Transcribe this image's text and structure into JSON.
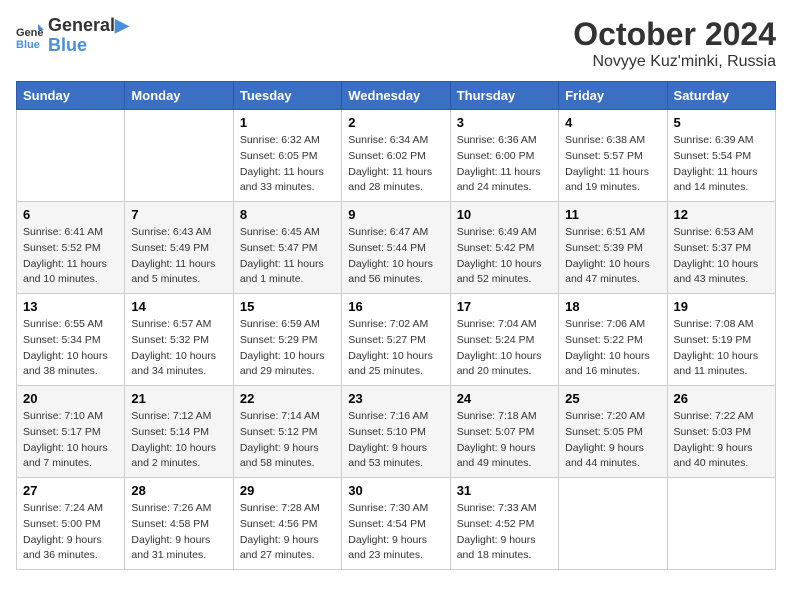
{
  "header": {
    "logo_line1": "General",
    "logo_line2": "Blue",
    "month": "October 2024",
    "location": "Novyye Kuz'minki, Russia"
  },
  "weekdays": [
    "Sunday",
    "Monday",
    "Tuesday",
    "Wednesday",
    "Thursday",
    "Friday",
    "Saturday"
  ],
  "weeks": [
    [
      {
        "day": "",
        "info": ""
      },
      {
        "day": "",
        "info": ""
      },
      {
        "day": "1",
        "info": "Sunrise: 6:32 AM\nSunset: 6:05 PM\nDaylight: 11 hours and 33 minutes."
      },
      {
        "day": "2",
        "info": "Sunrise: 6:34 AM\nSunset: 6:02 PM\nDaylight: 11 hours and 28 minutes."
      },
      {
        "day": "3",
        "info": "Sunrise: 6:36 AM\nSunset: 6:00 PM\nDaylight: 11 hours and 24 minutes."
      },
      {
        "day": "4",
        "info": "Sunrise: 6:38 AM\nSunset: 5:57 PM\nDaylight: 11 hours and 19 minutes."
      },
      {
        "day": "5",
        "info": "Sunrise: 6:39 AM\nSunset: 5:54 PM\nDaylight: 11 hours and 14 minutes."
      }
    ],
    [
      {
        "day": "6",
        "info": "Sunrise: 6:41 AM\nSunset: 5:52 PM\nDaylight: 11 hours and 10 minutes."
      },
      {
        "day": "7",
        "info": "Sunrise: 6:43 AM\nSunset: 5:49 PM\nDaylight: 11 hours and 5 minutes."
      },
      {
        "day": "8",
        "info": "Sunrise: 6:45 AM\nSunset: 5:47 PM\nDaylight: 11 hours and 1 minute."
      },
      {
        "day": "9",
        "info": "Sunrise: 6:47 AM\nSunset: 5:44 PM\nDaylight: 10 hours and 56 minutes."
      },
      {
        "day": "10",
        "info": "Sunrise: 6:49 AM\nSunset: 5:42 PM\nDaylight: 10 hours and 52 minutes."
      },
      {
        "day": "11",
        "info": "Sunrise: 6:51 AM\nSunset: 5:39 PM\nDaylight: 10 hours and 47 minutes."
      },
      {
        "day": "12",
        "info": "Sunrise: 6:53 AM\nSunset: 5:37 PM\nDaylight: 10 hours and 43 minutes."
      }
    ],
    [
      {
        "day": "13",
        "info": "Sunrise: 6:55 AM\nSunset: 5:34 PM\nDaylight: 10 hours and 38 minutes."
      },
      {
        "day": "14",
        "info": "Sunrise: 6:57 AM\nSunset: 5:32 PM\nDaylight: 10 hours and 34 minutes."
      },
      {
        "day": "15",
        "info": "Sunrise: 6:59 AM\nSunset: 5:29 PM\nDaylight: 10 hours and 29 minutes."
      },
      {
        "day": "16",
        "info": "Sunrise: 7:02 AM\nSunset: 5:27 PM\nDaylight: 10 hours and 25 minutes."
      },
      {
        "day": "17",
        "info": "Sunrise: 7:04 AM\nSunset: 5:24 PM\nDaylight: 10 hours and 20 minutes."
      },
      {
        "day": "18",
        "info": "Sunrise: 7:06 AM\nSunset: 5:22 PM\nDaylight: 10 hours and 16 minutes."
      },
      {
        "day": "19",
        "info": "Sunrise: 7:08 AM\nSunset: 5:19 PM\nDaylight: 10 hours and 11 minutes."
      }
    ],
    [
      {
        "day": "20",
        "info": "Sunrise: 7:10 AM\nSunset: 5:17 PM\nDaylight: 10 hours and 7 minutes."
      },
      {
        "day": "21",
        "info": "Sunrise: 7:12 AM\nSunset: 5:14 PM\nDaylight: 10 hours and 2 minutes."
      },
      {
        "day": "22",
        "info": "Sunrise: 7:14 AM\nSunset: 5:12 PM\nDaylight: 9 hours and 58 minutes."
      },
      {
        "day": "23",
        "info": "Sunrise: 7:16 AM\nSunset: 5:10 PM\nDaylight: 9 hours and 53 minutes."
      },
      {
        "day": "24",
        "info": "Sunrise: 7:18 AM\nSunset: 5:07 PM\nDaylight: 9 hours and 49 minutes."
      },
      {
        "day": "25",
        "info": "Sunrise: 7:20 AM\nSunset: 5:05 PM\nDaylight: 9 hours and 44 minutes."
      },
      {
        "day": "26",
        "info": "Sunrise: 7:22 AM\nSunset: 5:03 PM\nDaylight: 9 hours and 40 minutes."
      }
    ],
    [
      {
        "day": "27",
        "info": "Sunrise: 7:24 AM\nSunset: 5:00 PM\nDaylight: 9 hours and 36 minutes."
      },
      {
        "day": "28",
        "info": "Sunrise: 7:26 AM\nSunset: 4:58 PM\nDaylight: 9 hours and 31 minutes."
      },
      {
        "day": "29",
        "info": "Sunrise: 7:28 AM\nSunset: 4:56 PM\nDaylight: 9 hours and 27 minutes."
      },
      {
        "day": "30",
        "info": "Sunrise: 7:30 AM\nSunset: 4:54 PM\nDaylight: 9 hours and 23 minutes."
      },
      {
        "day": "31",
        "info": "Sunrise: 7:33 AM\nSunset: 4:52 PM\nDaylight: 9 hours and 18 minutes."
      },
      {
        "day": "",
        "info": ""
      },
      {
        "day": "",
        "info": ""
      }
    ]
  ]
}
